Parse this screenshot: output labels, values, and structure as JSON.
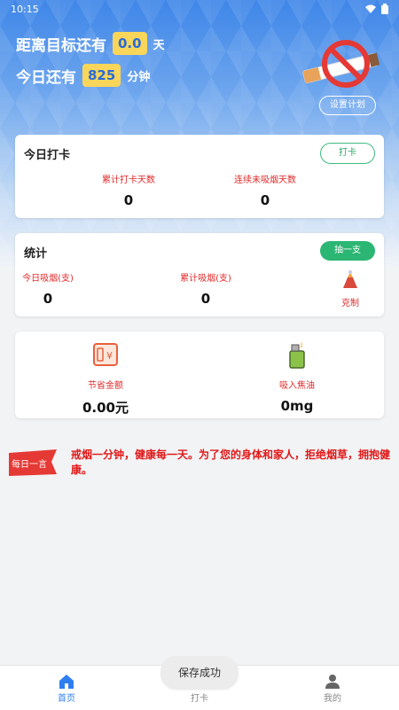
{
  "status_bar": {
    "time": "10:15"
  },
  "header": {
    "goal_prefix": "距离目标还有",
    "goal_value": "0.0",
    "goal_unit": "天",
    "today_prefix": "今日还有",
    "today_value": "825",
    "today_unit": "分钟",
    "plan_button": "设置计划"
  },
  "checkin_card": {
    "title": "今日打卡",
    "button": "打卡",
    "stats": [
      {
        "label": "累计打卡天数",
        "value": "0"
      },
      {
        "label": "连续未吸烟天数",
        "value": "0"
      }
    ]
  },
  "stats_card": {
    "title": "统计",
    "button": "抽一支",
    "stats": [
      {
        "label": "今日吸烟(支)",
        "value": "0"
      },
      {
        "label": "累计吸烟(支)",
        "value": "0"
      }
    ],
    "restrain_label": "克制"
  },
  "savings_card": {
    "items": [
      {
        "label": "节省金额",
        "value": "0.00元"
      },
      {
        "label": "吸入焦油",
        "value": "0mg"
      }
    ]
  },
  "quote": {
    "badge": "每日一言",
    "text": "戒烟一分钟，健康每一天。为了您的身体和家人，拒绝烟草，拥抱健康。"
  },
  "tabs": [
    {
      "label": "首页",
      "icon": "home-icon"
    },
    {
      "label": "打卡",
      "icon": "checkin-icon"
    },
    {
      "label": "我的",
      "icon": "user-icon"
    }
  ],
  "toast": "保存成功",
  "colors": {
    "accent": "#2f7ef0",
    "green": "#2bb673",
    "red": "#e02b2b",
    "pill": "#f9d65a"
  }
}
